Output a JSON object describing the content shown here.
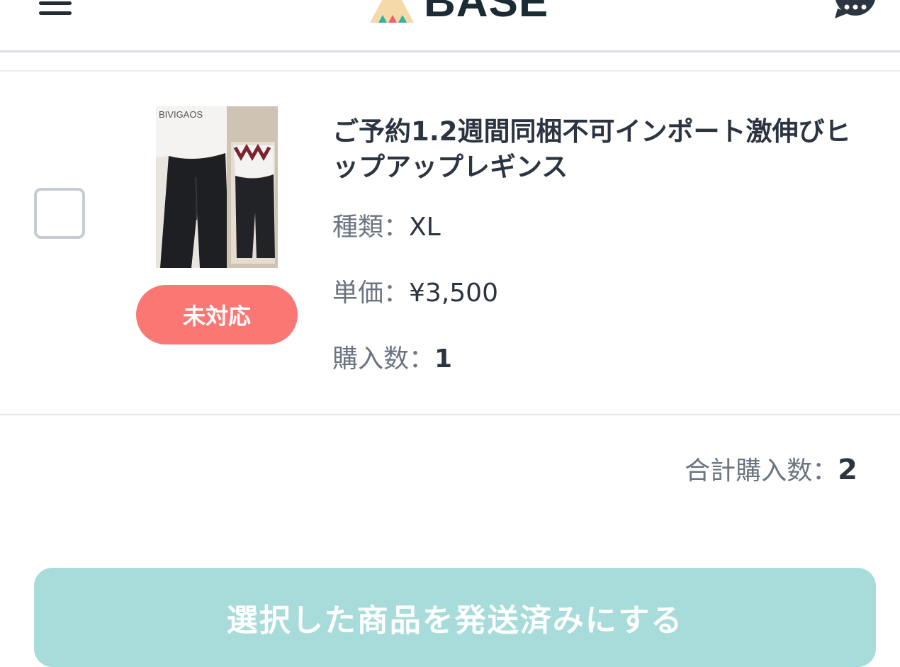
{
  "header": {
    "menu_icon": "hamburger-menu-icon",
    "logo_text": "BASE",
    "chat_icon": "chat-bubble-icon"
  },
  "item": {
    "title": "ご予約1.2週間同梱不可インポート激伸びヒップアップレギンス",
    "image_brand_text": "BIVIGAOS",
    "status": "未対応",
    "type_label": "種類：",
    "type_value": "XL",
    "price_label": "単価：",
    "price_value": "¥3,500",
    "qty_label": "購入数：",
    "qty_value": "1"
  },
  "summary": {
    "total_label": "合計購入数：",
    "total_value": "2"
  },
  "actions": {
    "ship_label": "選択した商品を発送済みにする"
  },
  "colors": {
    "status_pill": "#fa7774",
    "ship_button": "#a7dcdb",
    "text_dark": "#2b3440",
    "text_muted": "#6b7480"
  }
}
